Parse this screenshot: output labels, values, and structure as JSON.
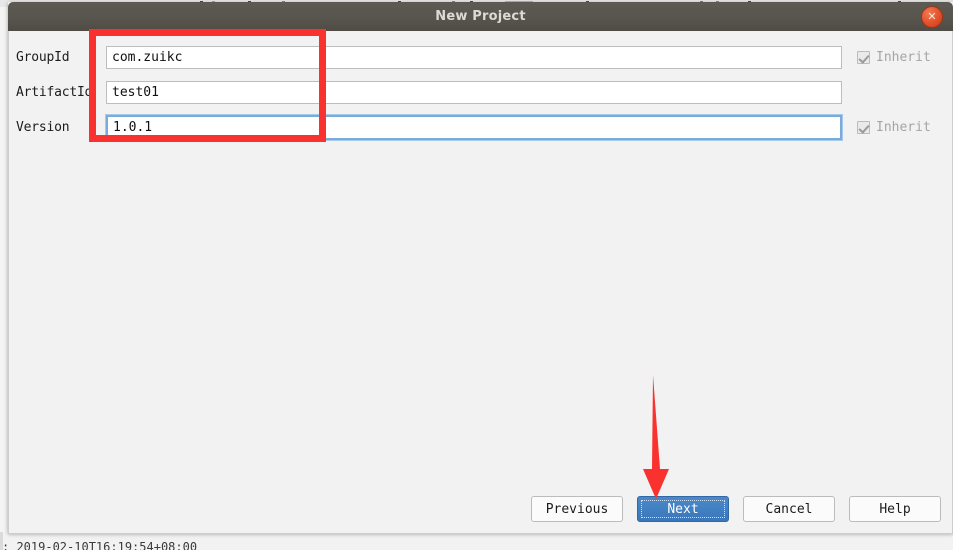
{
  "window": {
    "title": "New Project",
    "close_icon": "close-icon",
    "close_glyph": "✕"
  },
  "form": {
    "rows": [
      {
        "label": "GroupId",
        "value": "com.zuikc",
        "focused": false,
        "inherit": {
          "present": true,
          "label": "Inherit",
          "checked": true
        }
      },
      {
        "label": "ArtifactId",
        "value": "test01",
        "focused": false,
        "inherit": {
          "present": false,
          "label": "",
          "checked": false
        }
      },
      {
        "label": "Version",
        "value": "1.0.1",
        "focused": true,
        "inherit": {
          "present": true,
          "label": "Inherit",
          "checked": true
        }
      }
    ]
  },
  "buttons": {
    "previous": "Previous",
    "next": "Next",
    "cancel": "Cancel",
    "help": "Help"
  },
  "background": {
    "console_line": ": 2019-02-10T16:19:54+08:00"
  },
  "colors": {
    "titlebar": "#58554e",
    "title_text": "#dcdad5",
    "close_button": "#e2512a",
    "primary_button": "#4180c2",
    "focus_border": "#7aabdd",
    "annotation_red": "#f9322f",
    "dialog_background": "#f2f2f2",
    "input_background": "#ffffff"
  }
}
